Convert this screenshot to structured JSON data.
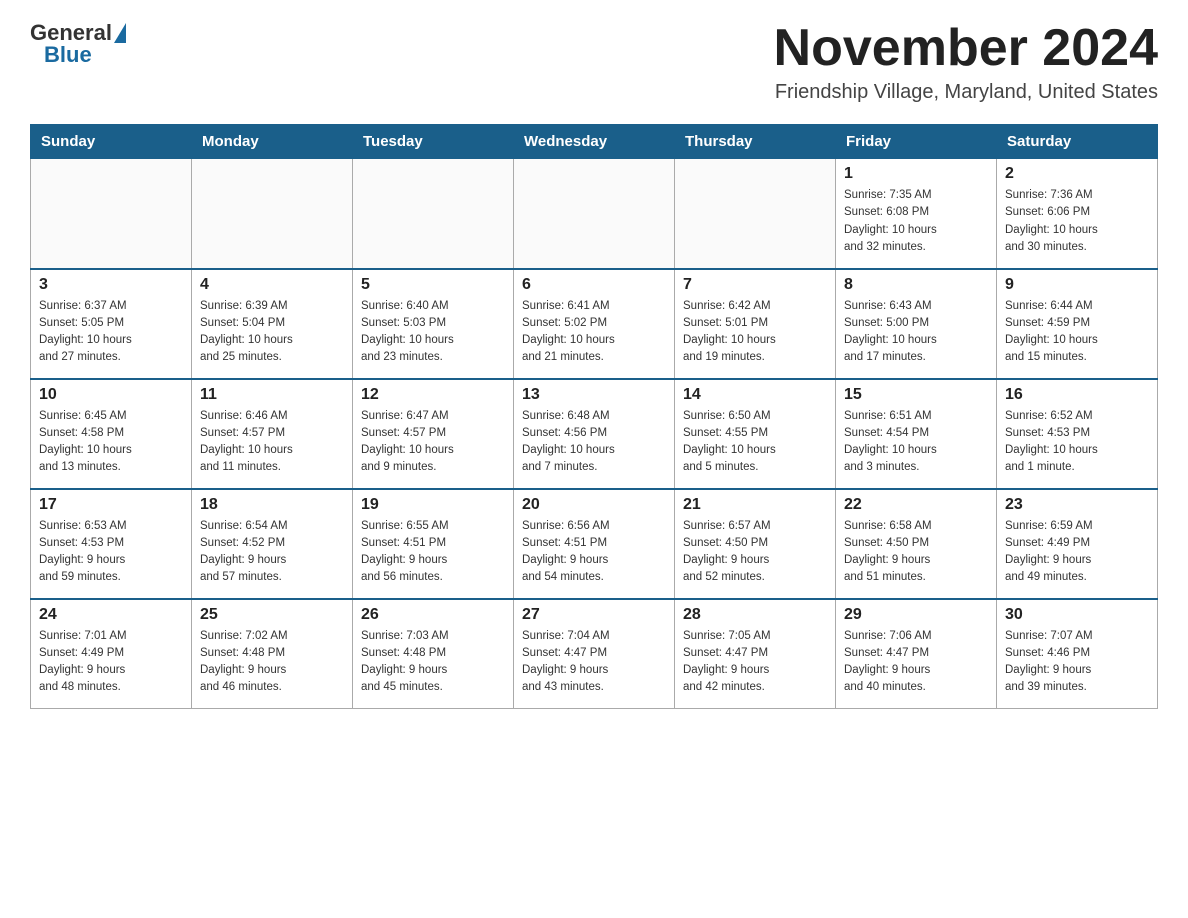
{
  "logo": {
    "general": "General",
    "blue": "Blue"
  },
  "title": "November 2024",
  "location": "Friendship Village, Maryland, United States",
  "weekdays": [
    "Sunday",
    "Monday",
    "Tuesday",
    "Wednesday",
    "Thursday",
    "Friday",
    "Saturday"
  ],
  "weeks": [
    {
      "days": [
        {
          "date": "",
          "info": ""
        },
        {
          "date": "",
          "info": ""
        },
        {
          "date": "",
          "info": ""
        },
        {
          "date": "",
          "info": ""
        },
        {
          "date": "",
          "info": ""
        },
        {
          "date": "1",
          "info": "Sunrise: 7:35 AM\nSunset: 6:08 PM\nDaylight: 10 hours\nand 32 minutes."
        },
        {
          "date": "2",
          "info": "Sunrise: 7:36 AM\nSunset: 6:06 PM\nDaylight: 10 hours\nand 30 minutes."
        }
      ]
    },
    {
      "days": [
        {
          "date": "3",
          "info": "Sunrise: 6:37 AM\nSunset: 5:05 PM\nDaylight: 10 hours\nand 27 minutes."
        },
        {
          "date": "4",
          "info": "Sunrise: 6:39 AM\nSunset: 5:04 PM\nDaylight: 10 hours\nand 25 minutes."
        },
        {
          "date": "5",
          "info": "Sunrise: 6:40 AM\nSunset: 5:03 PM\nDaylight: 10 hours\nand 23 minutes."
        },
        {
          "date": "6",
          "info": "Sunrise: 6:41 AM\nSunset: 5:02 PM\nDaylight: 10 hours\nand 21 minutes."
        },
        {
          "date": "7",
          "info": "Sunrise: 6:42 AM\nSunset: 5:01 PM\nDaylight: 10 hours\nand 19 minutes."
        },
        {
          "date": "8",
          "info": "Sunrise: 6:43 AM\nSunset: 5:00 PM\nDaylight: 10 hours\nand 17 minutes."
        },
        {
          "date": "9",
          "info": "Sunrise: 6:44 AM\nSunset: 4:59 PM\nDaylight: 10 hours\nand 15 minutes."
        }
      ]
    },
    {
      "days": [
        {
          "date": "10",
          "info": "Sunrise: 6:45 AM\nSunset: 4:58 PM\nDaylight: 10 hours\nand 13 minutes."
        },
        {
          "date": "11",
          "info": "Sunrise: 6:46 AM\nSunset: 4:57 PM\nDaylight: 10 hours\nand 11 minutes."
        },
        {
          "date": "12",
          "info": "Sunrise: 6:47 AM\nSunset: 4:57 PM\nDaylight: 10 hours\nand 9 minutes."
        },
        {
          "date": "13",
          "info": "Sunrise: 6:48 AM\nSunset: 4:56 PM\nDaylight: 10 hours\nand 7 minutes."
        },
        {
          "date": "14",
          "info": "Sunrise: 6:50 AM\nSunset: 4:55 PM\nDaylight: 10 hours\nand 5 minutes."
        },
        {
          "date": "15",
          "info": "Sunrise: 6:51 AM\nSunset: 4:54 PM\nDaylight: 10 hours\nand 3 minutes."
        },
        {
          "date": "16",
          "info": "Sunrise: 6:52 AM\nSunset: 4:53 PM\nDaylight: 10 hours\nand 1 minute."
        }
      ]
    },
    {
      "days": [
        {
          "date": "17",
          "info": "Sunrise: 6:53 AM\nSunset: 4:53 PM\nDaylight: 9 hours\nand 59 minutes."
        },
        {
          "date": "18",
          "info": "Sunrise: 6:54 AM\nSunset: 4:52 PM\nDaylight: 9 hours\nand 57 minutes."
        },
        {
          "date": "19",
          "info": "Sunrise: 6:55 AM\nSunset: 4:51 PM\nDaylight: 9 hours\nand 56 minutes."
        },
        {
          "date": "20",
          "info": "Sunrise: 6:56 AM\nSunset: 4:51 PM\nDaylight: 9 hours\nand 54 minutes."
        },
        {
          "date": "21",
          "info": "Sunrise: 6:57 AM\nSunset: 4:50 PM\nDaylight: 9 hours\nand 52 minutes."
        },
        {
          "date": "22",
          "info": "Sunrise: 6:58 AM\nSunset: 4:50 PM\nDaylight: 9 hours\nand 51 minutes."
        },
        {
          "date": "23",
          "info": "Sunrise: 6:59 AM\nSunset: 4:49 PM\nDaylight: 9 hours\nand 49 minutes."
        }
      ]
    },
    {
      "days": [
        {
          "date": "24",
          "info": "Sunrise: 7:01 AM\nSunset: 4:49 PM\nDaylight: 9 hours\nand 48 minutes."
        },
        {
          "date": "25",
          "info": "Sunrise: 7:02 AM\nSunset: 4:48 PM\nDaylight: 9 hours\nand 46 minutes."
        },
        {
          "date": "26",
          "info": "Sunrise: 7:03 AM\nSunset: 4:48 PM\nDaylight: 9 hours\nand 45 minutes."
        },
        {
          "date": "27",
          "info": "Sunrise: 7:04 AM\nSunset: 4:47 PM\nDaylight: 9 hours\nand 43 minutes."
        },
        {
          "date": "28",
          "info": "Sunrise: 7:05 AM\nSunset: 4:47 PM\nDaylight: 9 hours\nand 42 minutes."
        },
        {
          "date": "29",
          "info": "Sunrise: 7:06 AM\nSunset: 4:47 PM\nDaylight: 9 hours\nand 40 minutes."
        },
        {
          "date": "30",
          "info": "Sunrise: 7:07 AM\nSunset: 4:46 PM\nDaylight: 9 hours\nand 39 minutes."
        }
      ]
    }
  ]
}
